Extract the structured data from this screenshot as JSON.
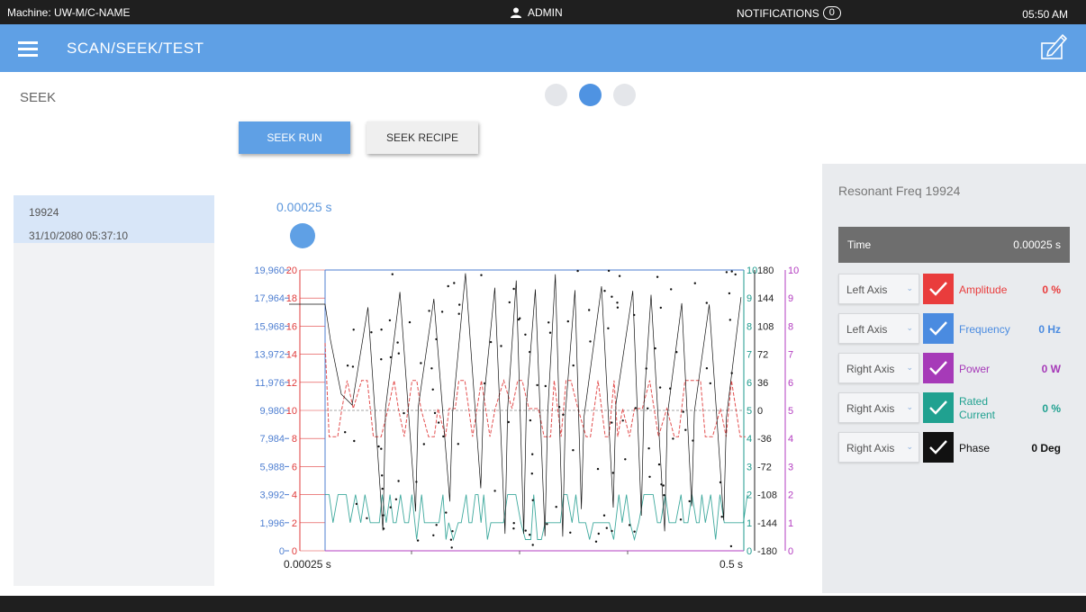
{
  "topbar": {
    "machine": "Machine: UW-M/C-NAME",
    "user": "ADMIN",
    "notifications_label": "NOTIFICATIONS",
    "notifications_count": "0",
    "time": "05:50 AM"
  },
  "header": {
    "title": "SCAN/SEEK/TEST"
  },
  "section_title": "SEEK",
  "pager": {
    "pages": 3,
    "active": 2
  },
  "buttons": {
    "seek_run": "SEEK RUN",
    "seek_recipe": "SEEK RECIPE"
  },
  "history": [
    {
      "value": "19924",
      "timestamp": "31/10/2080 05:37:10"
    }
  ],
  "cursor_time": "0.00025 s",
  "chart_data": {
    "type": "line",
    "x_start_label": "0.00025 s",
    "x_end_label": "0.5 s",
    "axes": {
      "frequency": {
        "ticks": [
          "0",
          "1,996",
          "3,992",
          "5,988",
          "7,984",
          "9,980",
          "11,976",
          "13,972",
          "15,968",
          "17,964",
          "19,960"
        ],
        "color": "#4f7fd1"
      },
      "amplitude": {
        "ticks": [
          "0",
          "2",
          "4",
          "6",
          "8",
          "10",
          "12",
          "14",
          "16",
          "18",
          "20"
        ],
        "color": "#e03c3c"
      },
      "current": {
        "ticks": [
          "0",
          "1",
          "2",
          "3",
          "4",
          "5",
          "6",
          "7",
          "8",
          "9",
          "10"
        ],
        "color": "#1c9a8c"
      },
      "phase": {
        "ticks": [
          "-180",
          "-144",
          "-108",
          "-72",
          "-36",
          "0",
          "36",
          "72",
          "108",
          "144",
          "180"
        ],
        "color": "#222222"
      },
      "power": {
        "ticks": [
          "0",
          "1",
          "2",
          "3",
          "4",
          "5",
          "6",
          "7",
          "8",
          "9",
          "10"
        ],
        "color": "#b33cc0"
      }
    }
  },
  "details": {
    "title": "Resonant Freq 19924",
    "time_label": "Time",
    "time_value": "0.00025 s",
    "series": [
      {
        "axis": "Left Axis",
        "name": "Amplitude",
        "value": "0 %",
        "color": "#e93c3c"
      },
      {
        "axis": "Left Axis",
        "name": "Frequency",
        "value": "0 Hz",
        "color": "#4a8be0"
      },
      {
        "axis": "Right Axis",
        "name": "Power",
        "value": "0 W",
        "color": "#a63ab8"
      },
      {
        "axis": "Right Axis",
        "name": "Rated Current",
        "value": "0 %",
        "color": "#20a190"
      },
      {
        "axis": "Right Axis",
        "name": "Phase",
        "value": "0 Deg",
        "color": "#111111"
      }
    ]
  },
  "icons": {
    "menu": "hamburger-icon",
    "user": "user-icon",
    "edit": "edit-icon",
    "check": "check-icon",
    "chevron": "chevron-down-icon"
  }
}
